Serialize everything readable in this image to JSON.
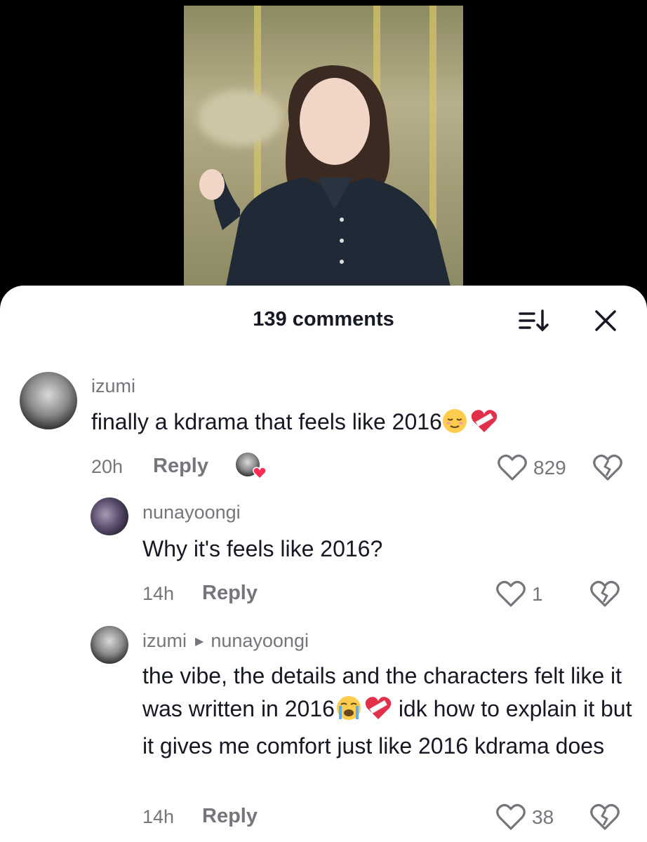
{
  "header": {
    "title": "139 comments"
  },
  "comments": [
    {
      "username": "izumi",
      "text": "finally a kdrama that feels like 2016",
      "time": "20h",
      "reply_label": "Reply",
      "likes": "829"
    },
    {
      "username": "nunayoongi",
      "text": "Why it's feels like 2016?",
      "time": "14h",
      "reply_label": "Reply",
      "likes": "1"
    },
    {
      "username": "izumi",
      "reply_to": "nunayoongi",
      "text_part1": "the vibe, the details and the characters felt like it was written in 2016",
      "text_part2": " idk how to explain it but it gives me comfort just like 2016 kdrama does",
      "time": "14h",
      "reply_label": "Reply",
      "likes": "38"
    }
  ],
  "icons": {
    "sort": "sort-icon",
    "close": "close-icon",
    "like": "heart-outline-icon",
    "dislike": "broken-heart-icon",
    "emoji_relieved": "relieved-face-emoji",
    "emoji_mending_heart": "mending-heart-emoji",
    "emoji_crying": "loudly-crying-face-emoji"
  },
  "colors": {
    "text_primary": "#161823",
    "text_secondary": "#75767c",
    "accent_red": "#fe2c55"
  }
}
